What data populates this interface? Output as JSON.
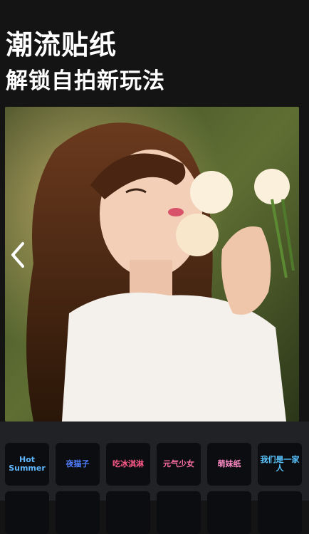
{
  "header": {
    "title": "潮流贴纸",
    "subtitle": "解锁自拍新玩法"
  },
  "preview": {
    "prev_icon": "chevron-left-icon"
  },
  "stickers": [
    {
      "label": "Hot Summer",
      "color": "#5fb8ff"
    },
    {
      "label": "夜猫子",
      "color": "#4f7dff"
    },
    {
      "label": "吃冰淇淋",
      "color": "#ff5a8a"
    },
    {
      "label": "元气少女",
      "color": "#ff6fa4"
    },
    {
      "label": "萌妹纸",
      "color": "#ff8cc6"
    },
    {
      "label": "我们是一家人",
      "color": "#58c4ff"
    }
  ]
}
